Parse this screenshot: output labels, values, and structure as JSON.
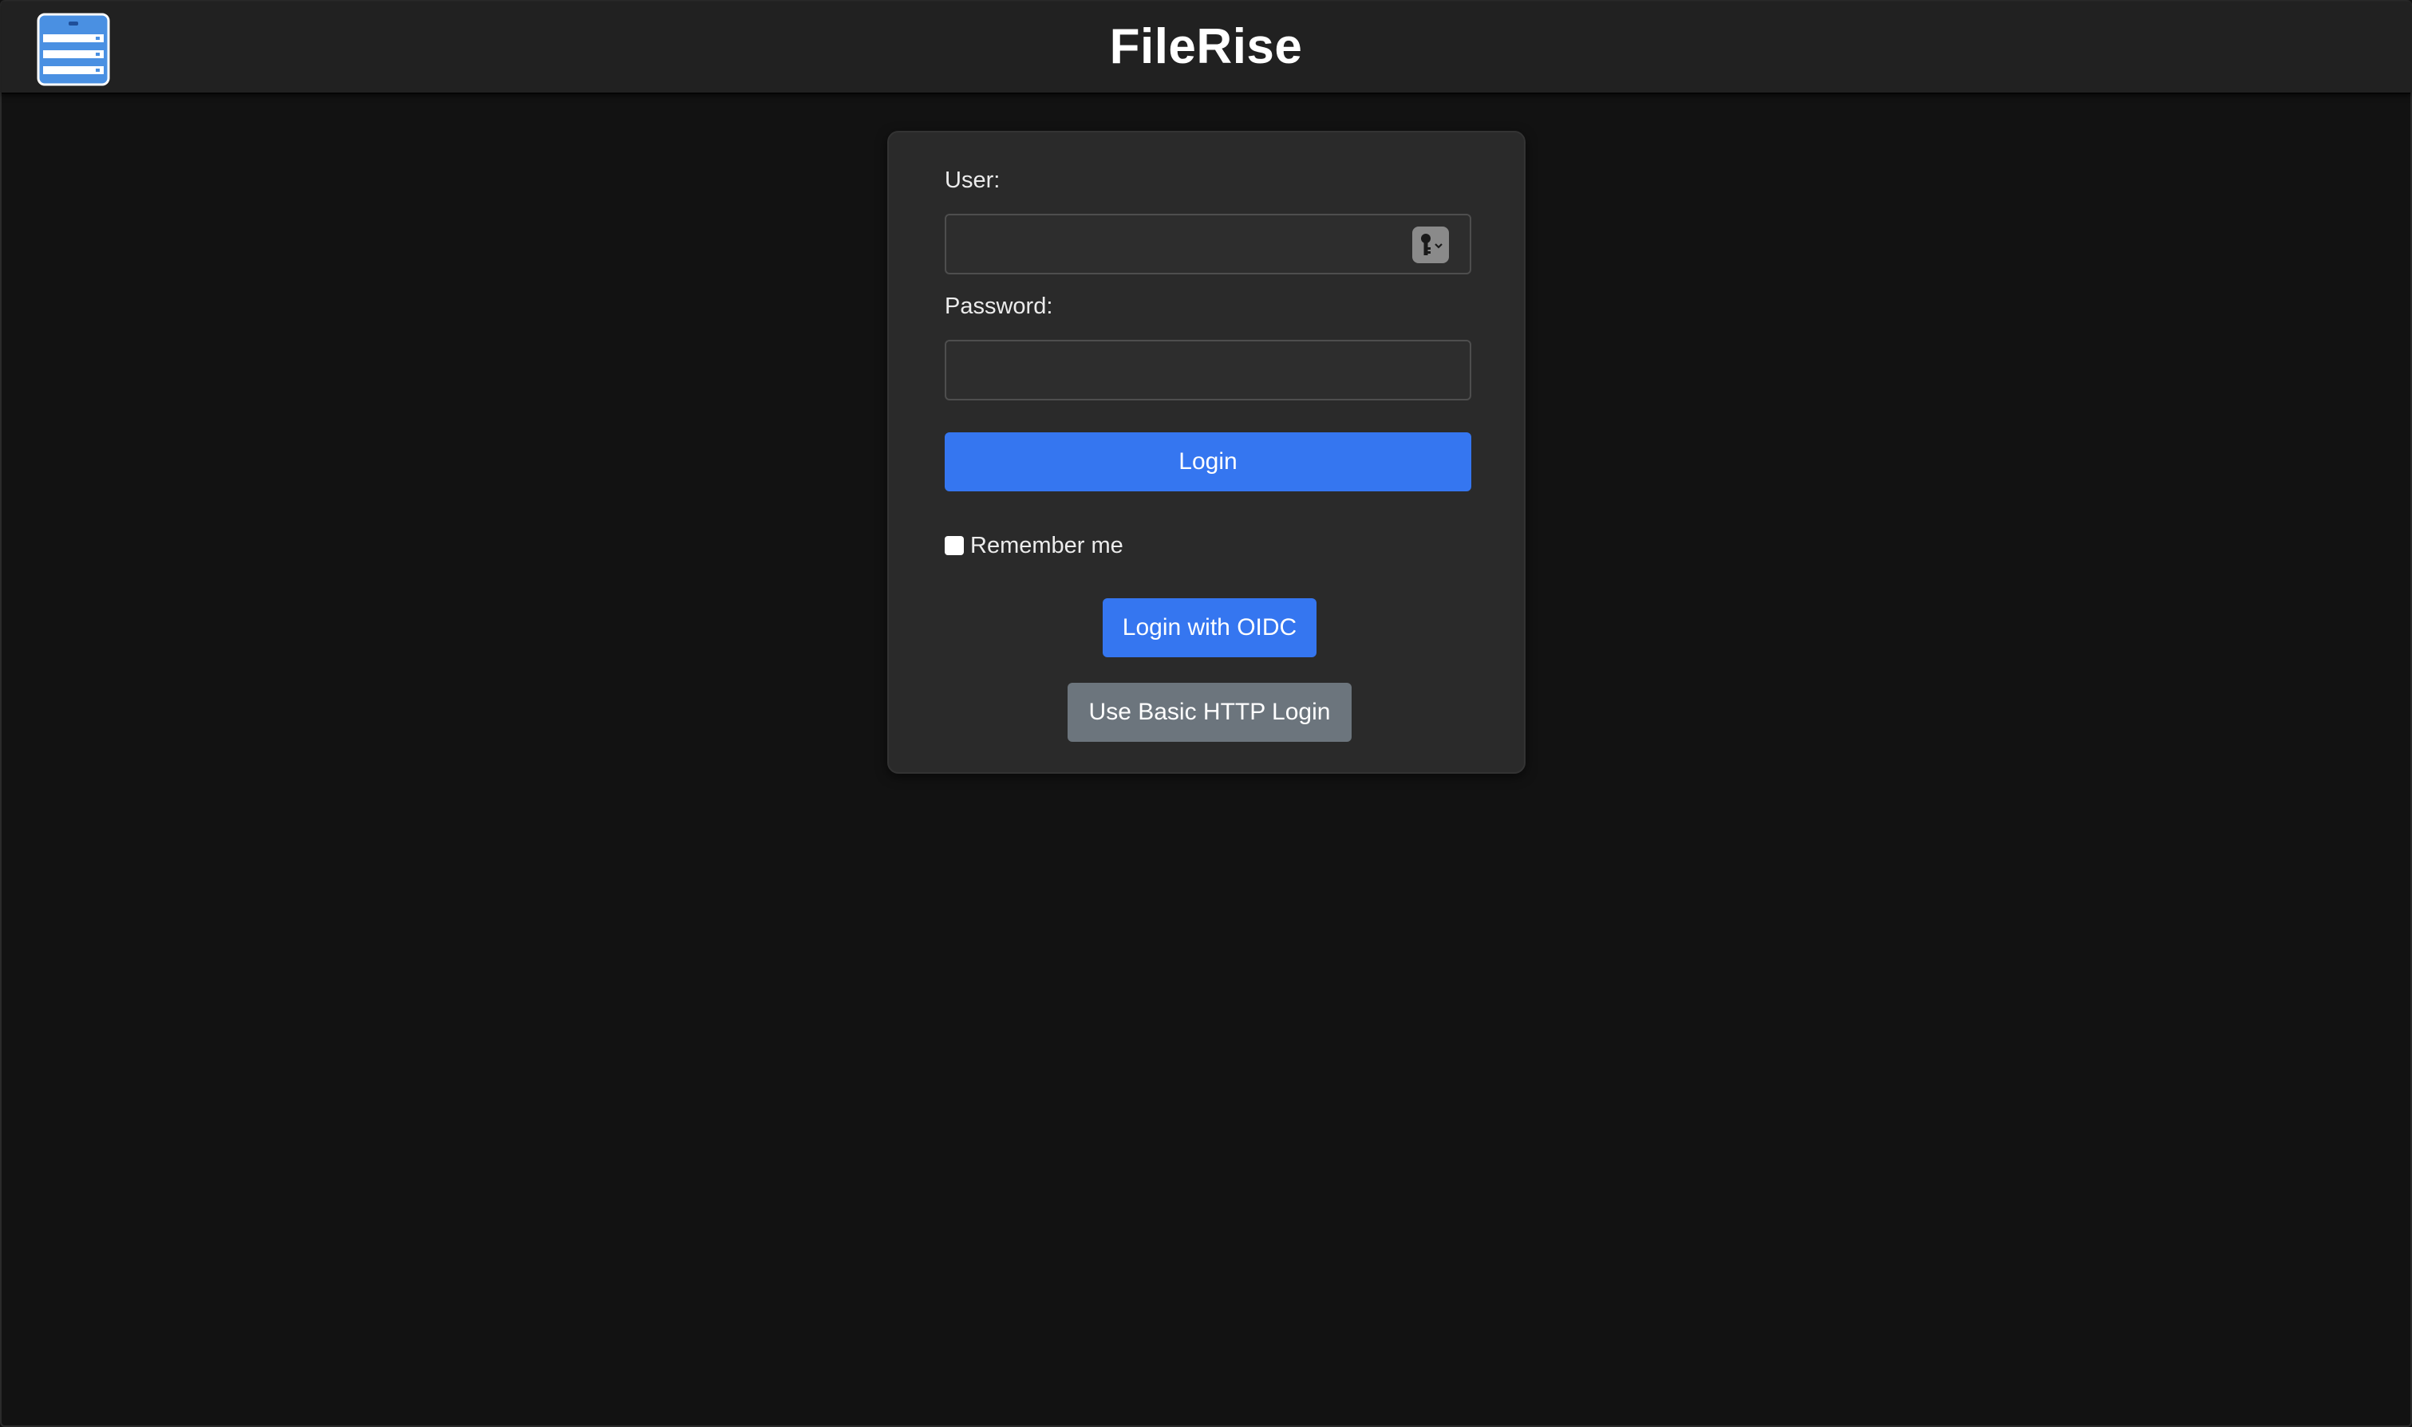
{
  "header": {
    "title": "FileRise",
    "logo_icon": "file-cabinet-icon",
    "accent": "#4a90e2"
  },
  "login": {
    "user_label": "User:",
    "user_value": "",
    "password_label": "Password:",
    "password_value": "",
    "password_manager_icon": "key-icon",
    "login_button": "Login",
    "remember_label": "Remember me",
    "remember_checked": false,
    "oidc_button": "Login with OIDC",
    "basic_http_button": "Use Basic HTTP Login"
  },
  "colors": {
    "primary": "#3576f0",
    "secondary": "#6c757d",
    "background": "#121212",
    "card": "#2a2a2a"
  }
}
